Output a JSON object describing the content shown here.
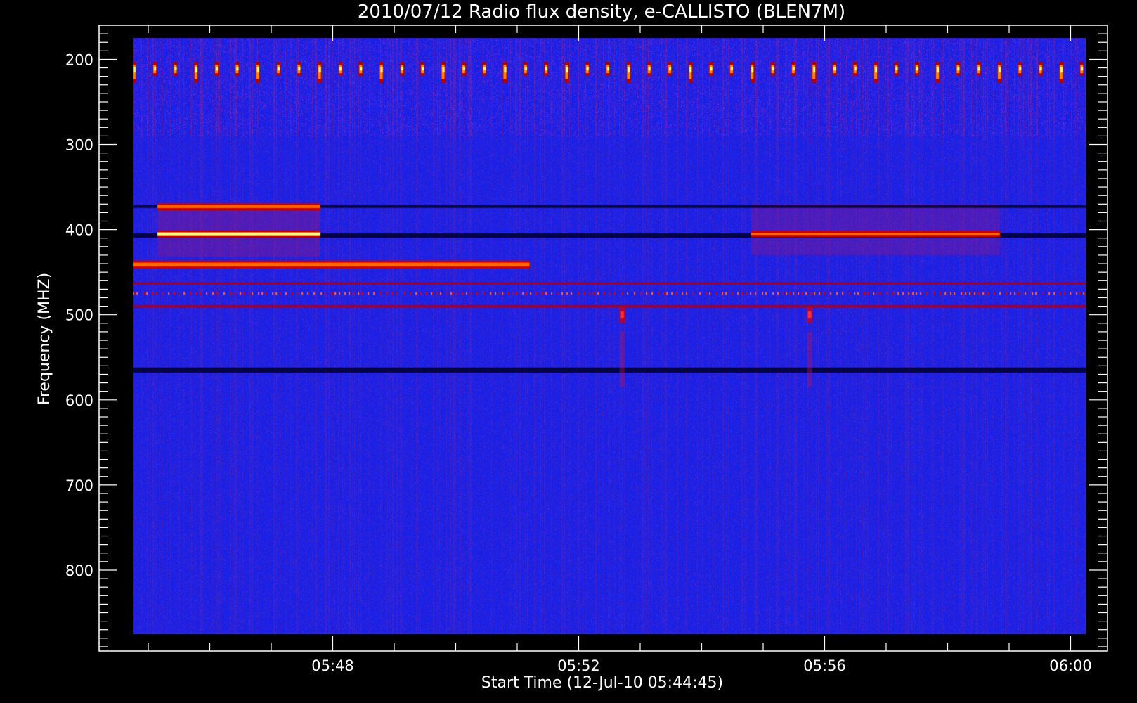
{
  "chart_data": {
    "type": "heatmap",
    "title": "2010/07/12  Radio flux density, e-CALLISTO (BLEN7M)",
    "xlabel": "Start Time (12-Jul-10 05:44:45)",
    "ylabel": "Frequency (MHZ)",
    "x_start_minutes": 344.75,
    "x_end_minutes": 360.25,
    "x_axis_range_minutes": [
      344.2,
      360.6
    ],
    "y_axis_range_mhz": [
      160,
      895
    ],
    "y_data_range_mhz": [
      175,
      875
    ],
    "x_ticks": [
      {
        "value": 348,
        "label": "05:48"
      },
      {
        "value": 352,
        "label": "05:52"
      },
      {
        "value": 356,
        "label": "05:56"
      },
      {
        "value": 360,
        "label": "06:00"
      }
    ],
    "y_ticks": [
      {
        "value": 200,
        "label": "200"
      },
      {
        "value": 300,
        "label": "300"
      },
      {
        "value": 400,
        "label": "400"
      },
      {
        "value": 500,
        "label": "500"
      },
      {
        "value": 600,
        "label": "600"
      },
      {
        "value": 700,
        "label": "700"
      },
      {
        "value": 800,
        "label": "800"
      }
    ],
    "colormap": [
      "#000000",
      "#0000d8",
      "#d00000",
      "#ff6a00",
      "#ffff80"
    ],
    "background_color": "#1a1fe6",
    "features": [
      {
        "name": "periodic-spikes-210MHz",
        "freq_mhz": 213,
        "t_start": 344.75,
        "t_end": 360.25,
        "period_minutes": 0.335,
        "intensity": 0.95
      },
      {
        "name": "band-373MHz-a",
        "freq_mhz": 373,
        "width_mhz": 5,
        "t_start": 345.15,
        "t_end": 347.8,
        "intensity": 0.7
      },
      {
        "name": "band-405MHz-a",
        "freq_mhz": 405,
        "width_mhz": 5,
        "t_start": 345.15,
        "t_end": 347.8,
        "intensity": 0.95
      },
      {
        "name": "box-385-430MHz-a",
        "freq_lo": 370,
        "freq_hi": 432,
        "t_start": 345.15,
        "t_end": 347.8,
        "intensity": 0.35
      },
      {
        "name": "band-440MHz",
        "freq_mhz": 441,
        "width_mhz": 6,
        "t_start": 344.75,
        "t_end": 351.2,
        "intensity": 0.8
      },
      {
        "name": "band-405MHz-b",
        "freq_mhz": 405,
        "width_mhz": 4,
        "t_start": 354.8,
        "t_end": 358.85,
        "intensity": 0.8
      },
      {
        "name": "box-370-430MHz-b",
        "freq_lo": 370,
        "freq_hi": 430,
        "t_start": 354.8,
        "t_end": 358.85,
        "intensity": 0.3
      },
      {
        "name": "dark-line-373MHz",
        "freq_mhz": 373,
        "width_mhz": 3,
        "t_start": 344.75,
        "t_end": 360.25,
        "intensity": 0.0
      },
      {
        "name": "dark-line-407MHz",
        "freq_mhz": 407,
        "width_mhz": 5,
        "t_start": 344.75,
        "t_end": 360.25,
        "intensity": 0.0
      },
      {
        "name": "line-463MHz",
        "freq_mhz": 463,
        "width_mhz": 3,
        "t_start": 344.75,
        "t_end": 360.25,
        "intensity": 0.5
      },
      {
        "name": "dotted-line-475MHz",
        "freq_mhz": 475,
        "width_mhz": 3,
        "t_start": 344.75,
        "t_end": 360.25,
        "intensity": 0.75
      },
      {
        "name": "line-490MHz",
        "freq_mhz": 490,
        "width_mhz": 3,
        "t_start": 344.75,
        "t_end": 360.25,
        "intensity": 0.5
      },
      {
        "name": "burst-500MHz-a",
        "freq_mhz": 500,
        "t_center": 352.7,
        "intensity": 0.8
      },
      {
        "name": "burst-500MHz-b",
        "freq_mhz": 500,
        "t_center": 355.75,
        "intensity": 0.8
      },
      {
        "name": "dark-line-565MHz",
        "freq_mhz": 565,
        "width_mhz": 6,
        "t_start": 344.75,
        "t_end": 360.25,
        "intensity": 0.05
      }
    ]
  }
}
